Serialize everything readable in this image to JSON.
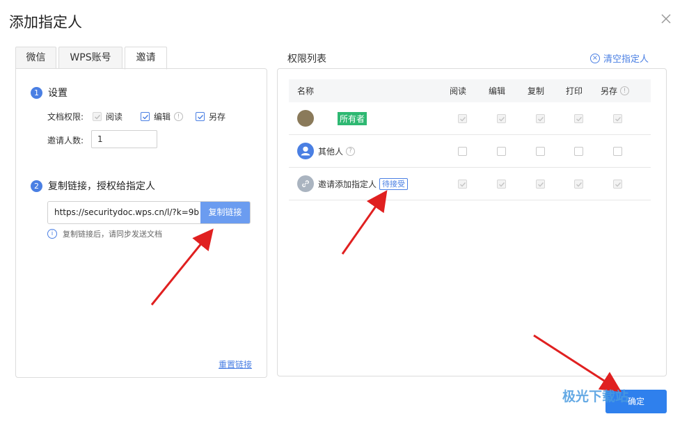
{
  "dialog": {
    "title": "添加指定人"
  },
  "tabs": [
    {
      "label": "微信",
      "active": false
    },
    {
      "label": "WPS账号",
      "active": false
    },
    {
      "label": "邀请",
      "active": true
    }
  ],
  "settings": {
    "step1_num": "1",
    "step1_title": "设置",
    "doc_perm_label": "文档权限:",
    "perm_read": "阅读",
    "perm_edit": "编辑",
    "perm_saveas": "另存",
    "count_label": "邀请人数:",
    "count_value": "1"
  },
  "share": {
    "step2_num": "2",
    "step2_title": "复制链接，授权给指定人",
    "link": "https://securitydoc.wps.cn/l/?k=9b",
    "copy_label": "复制链接",
    "hint": "复制链接后，请同步发送文档",
    "reset_label": "重置链接"
  },
  "permissions": {
    "title": "权限列表",
    "clear_label": "清空指定人",
    "columns": [
      "名称",
      "阅读",
      "编辑",
      "复制",
      "打印",
      "另存"
    ],
    "rows": [
      {
        "name": "",
        "tag": "所有者",
        "checks": [
          true,
          true,
          true,
          true,
          true
        ],
        "disabled": true
      },
      {
        "name": "其他人",
        "tag": "",
        "checks": [
          false,
          false,
          false,
          false,
          false
        ],
        "disabled": false
      },
      {
        "name": "邀请添加指定人",
        "tag": "待接受",
        "checks": [
          true,
          true,
          true,
          true,
          true
        ],
        "disabled": true
      }
    ]
  },
  "footer": {
    "confirm_label": "确定"
  },
  "watermark": {
    "text": "极光下载站"
  },
  "colors": {
    "accent": "#4a7fe3",
    "owner_tag": "#2eb872",
    "arrow": "#e02020"
  }
}
